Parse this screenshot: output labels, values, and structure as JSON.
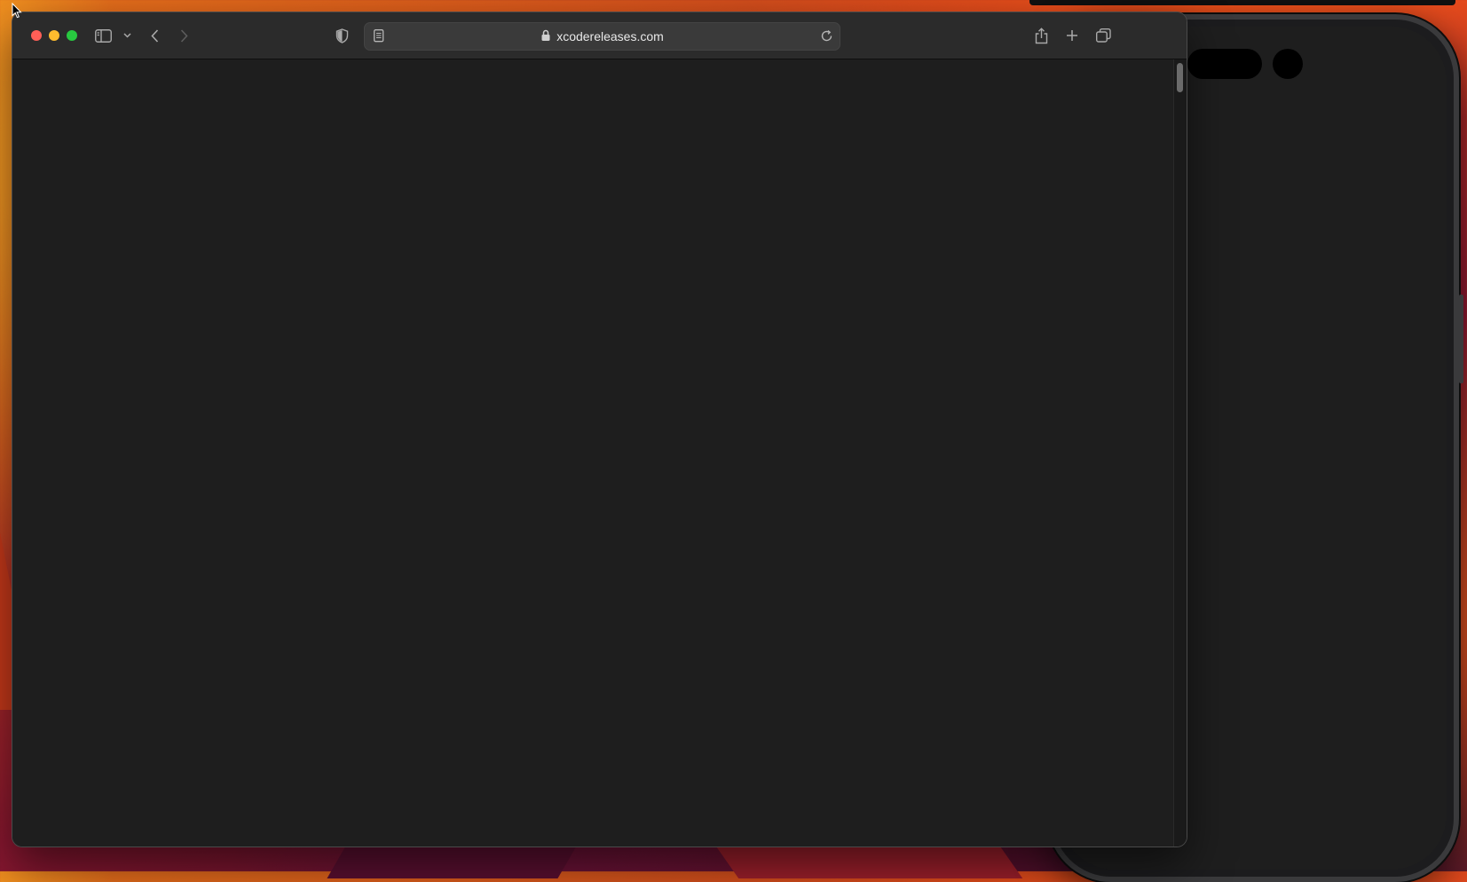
{
  "browser": {
    "address_bar": {
      "url": "xcodereleases.com"
    }
  },
  "icons": {
    "close": "close-traffic-light",
    "minimize": "minimize-traffic-light",
    "maximize": "zoom-traffic-light",
    "sidebar": "sidebar-icon",
    "sidebar_menu": "chevron-down-icon",
    "back": "chevron-left-icon",
    "forward": "chevron-right-icon",
    "privacy": "shield-icon",
    "reader": "reader-icon",
    "lock": "lock-icon",
    "reload": "reload-icon",
    "share": "share-icon",
    "new_tab": "plus-icon",
    "tab_overview": "tab-overview-icon"
  },
  "colors": {
    "close": "#ff5f57",
    "minimize": "#febc2e",
    "maximize": "#28c840",
    "page_background": "#1e1e1e",
    "toolbar": "#2b2b2b"
  }
}
